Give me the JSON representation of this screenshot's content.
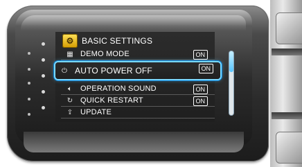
{
  "menu": {
    "header": {
      "icon": "wrench-settings-icon",
      "title": "BASIC SETTINGS"
    },
    "items": [
      {
        "icon": "demo-icon",
        "label": "DEMO MODE",
        "value": "ON",
        "selected": false
      },
      {
        "icon": "auto-power-off-icon",
        "label": "AUTO POWER OFF",
        "value": "ON",
        "selected": true
      },
      {
        "icon": "speaker-icon",
        "label": "OPERATION SOUND",
        "value": "ON",
        "selected": false
      },
      {
        "icon": "quick-restart-icon",
        "label": "QUICK RESTART",
        "value": "ON",
        "selected": false
      },
      {
        "icon": "update-icon",
        "label": "UPDATE",
        "value": "",
        "selected": false
      }
    ]
  },
  "colors": {
    "highlight": "#7ad8ff",
    "header_icon": "#f3c31b"
  }
}
